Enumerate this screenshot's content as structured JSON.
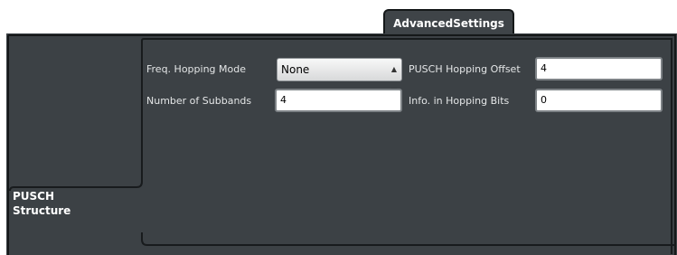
{
  "tabs": {
    "top_active": "AdvancedSettings",
    "side_line1": "PUSCH",
    "side_line2": "Structure"
  },
  "form": {
    "freq_hopping_mode": {
      "label": "Freq. Hopping Mode",
      "value": "None"
    },
    "num_subbands": {
      "label": "Number of Subbands",
      "value": "4"
    },
    "pusch_hopping_offset": {
      "label": "PUSCH Hopping Offset",
      "value": "4"
    },
    "info_hopping_bits": {
      "label": "Info. in Hopping Bits",
      "value": "0"
    }
  },
  "icons": {
    "select_arrow": "updown-arrow-icon"
  },
  "colors": {
    "panel": "#3c4145",
    "frame": "#151819",
    "label": "#e4e6e7"
  }
}
